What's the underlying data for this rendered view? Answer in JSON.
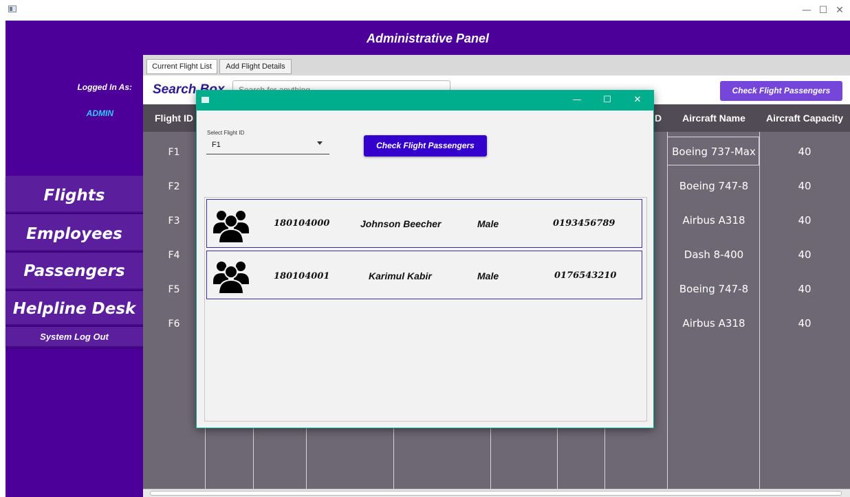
{
  "window": {
    "minimize": "—",
    "maximize": "☐",
    "close": "✕"
  },
  "header": {
    "title": "Administrative Panel"
  },
  "sidebar": {
    "logged_in_label": "Logged In As:",
    "user": "ADMIN",
    "items": [
      {
        "label": "Flights"
      },
      {
        "label": "Employees"
      },
      {
        "label": "Passengers"
      },
      {
        "label": "Helpline Desk"
      },
      {
        "label": "System Log Out"
      }
    ]
  },
  "tabs": [
    {
      "label": "Current Flight List",
      "active": true
    },
    {
      "label": "Add Flight Details",
      "active": false
    }
  ],
  "search": {
    "label": "Search Box",
    "placeholder": "Search for anything"
  },
  "main_button": "Check Flight Passengers",
  "table": {
    "headers": {
      "flight_id": "Flight ID",
      "partial": "D",
      "aircraft_name": "Aircraft Name",
      "aircraft_capacity": "Aircraft Capacity"
    },
    "rows": [
      {
        "id": "F1",
        "aircraft": "Boeing 737-Max",
        "capacity": "40"
      },
      {
        "id": "F2",
        "aircraft": "Boeing 747-8",
        "capacity": "40"
      },
      {
        "id": "F3",
        "aircraft": "Airbus A318",
        "capacity": "40"
      },
      {
        "id": "F4",
        "aircraft": "Dash 8-400",
        "capacity": "40"
      },
      {
        "id": "F5",
        "aircraft": "Boeing 747-8",
        "capacity": "40"
      },
      {
        "id": "F6",
        "aircraft": "Airbus A318",
        "capacity": "40"
      }
    ]
  },
  "modal": {
    "select_label": "Select Flight ID",
    "selected_flight": "F1",
    "button": "Check Flight Passengers",
    "passengers": [
      {
        "id": "180104000",
        "name": "Johnson Beecher",
        "gender": "Male",
        "phone": "0193456789",
        "icon": "users-group-icon"
      },
      {
        "id": "180104001",
        "name": "Karimul Kabir",
        "gender": "Male",
        "phone": "0176543210",
        "icon": "users-group-icon"
      }
    ]
  },
  "colors": {
    "purple": "#4d0099",
    "teal": "#00ad8c",
    "table_bg": "#6e6875",
    "button_blue": "#3300cc",
    "button_violet": "#7546d9"
  }
}
